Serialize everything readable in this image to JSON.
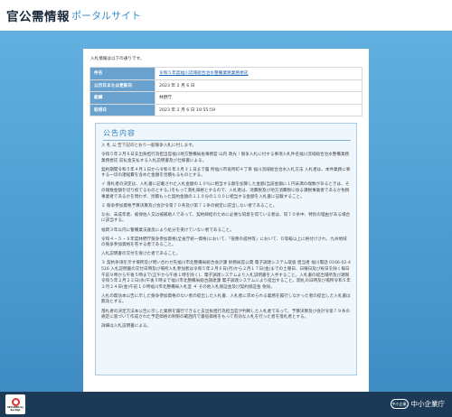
{
  "header": {
    "title": "官公需情報",
    "subtitle": "ポータルサイト"
  },
  "intro": "入札情報は以下の通りです。",
  "info_rows": [
    {
      "label": "件名",
      "value": "令和５年度福川流域総合治水整備業務業務委託",
      "link": true
    },
    {
      "label": "公示日または更新日",
      "value": "2023 年 2 月 6 日",
      "link": false
    },
    {
      "label": "組織",
      "value": "林野庁",
      "link": false
    },
    {
      "label": "取得日",
      "value": "2023 年 2 月 6 日 19:55:59",
      "link": false
    }
  ],
  "notice": {
    "title": "公告内容",
    "paragraphs": [
      "入 札 公 告下記のとおり一般競争入札に付します。",
      "令和５年２月６日支出負担行為担当官福川地方整備局長事務官 山内 政光 ! 競争入札に付する事項入札件名福川流域総合治水整備業務業務委託 前払金支払する入札説明書及び仕様書による。",
      "契約期間令和５年４月１日から令和６年３月３１日まで履 所福川市役所町４丁目 福川流域総合治水入札方法 入札者は、本件業務に要する一切の諸経費を含めた金額を見積もるものとする。",
      "イ 落札者の決定は、入札書に記載された入札金額の１０％に相当する額を加算した金額(当該金額に１円未満の端数があるときは、その端数金額を切り捨てるものとする。)をもって落札価格とするので、入札者は、消費税及び地方消費税に係る課税事業者であるか免税事業者であるかを問わず、見積もった契約金額の１１０分の１００に相当する金額を入札書に記載すること。",
      "２ 競争参加資格予算決算及び会計令第７０条及び第７１条の規定に該当しない者であること。",
      "なお、未成年者、被保佐人又は被補助人であって、契約締結のために必要な同意を得ている者は、同７０条中、特別の理由がある場合に該当する。",
      "福岡３年以内に警備業法違反により処分を受けていない者であること。",
      "令和４・５・６年度林野庁競争参加資格(全省庁統一資格)において、「役務の提供等」において、Ｄ等級以上に格付けされ、九州地域の競争参加資格を有する者であること。",
      "入札説明書の交付を受けた者であること。",
      "３ 契約条項を示す場所及び問い合わせ先福川市北整備局総合会計課 財務局官公需 電子調達システム取扱 担当者 福川電話 0166-02-4516 入札説明書の交付日時及び場所入札参加者は令和５年２月６日(月)から２月１７日(金)までの土曜日、日曜日及び祝日を除く毎日午前９時から午後５時まで(正午から午後１時を除く)、電子調達システムより入札説明書を入手すること。入札書の提出場所及び期限令和５年２月２２日(水)午後５時まで福川市北整備局総合調達課 電子調達システムにより提出すること。開札の日時及び場所令和５年２月２４日(金)午前１０時福川市北整備局入札室 ４ その他入札保証金及び契約保証金 免除。",
      "入札の無効本公告に示した競争参加資格のない者の提出した入札書、入札者に求められる義務を履行しなかった者の提出した入札書は無効とする。",
      "落札者の決定方法本公告に示した業務を履行できると支出負担行為担当官が判断した入札者であって、予算決算及び会計令第７９条の規定に基づいて作成された予定価格の制限の範囲内で最低価格をもって有効な入札を行った者を落札者とする。",
      "詳細は入札説明書による。"
    ]
  },
  "footer": {
    "secured_label": "SECURED by Sectigo",
    "brand_mark": "中小企業",
    "brand_name": "中小企業庁"
  }
}
